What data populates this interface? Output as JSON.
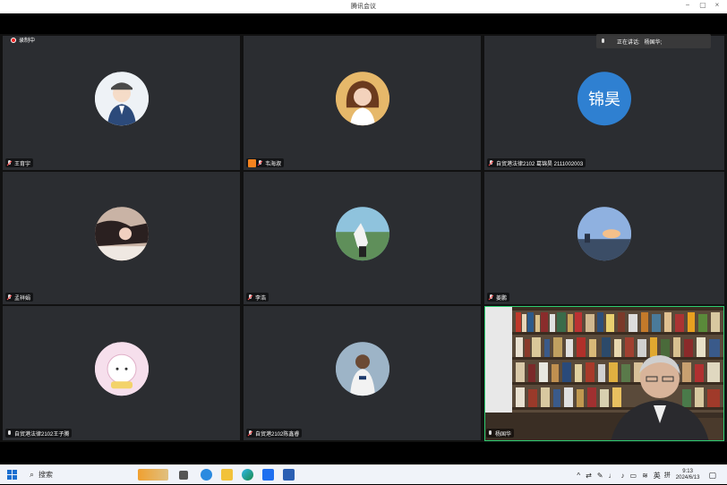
{
  "window": {
    "title": "腾讯会议",
    "controls": [
      "−",
      "▢",
      "×"
    ]
  },
  "recording": {
    "label": "录制中"
  },
  "speaking": {
    "label": "正在讲话:",
    "name": "杨国华;"
  },
  "participants": [
    {
      "name": "王育宇",
      "muted": true,
      "host": false,
      "avatar": "police-cartoon",
      "color": "#e8eef5"
    },
    {
      "name": "韦海淑",
      "muted": true,
      "host": true,
      "avatar": "woman-photo",
      "color": "#d9a35a"
    },
    {
      "name": "自贸港法律2102 葛锦昊 2111002003",
      "muted": true,
      "host": false,
      "avatar": "text",
      "avatar_text": "锦昊",
      "color": "#2f80d1"
    },
    {
      "name": "孟祥娟",
      "muted": true,
      "host": false,
      "avatar": "photo",
      "color": "#b99a8a"
    },
    {
      "name": "李浩",
      "muted": true,
      "host": false,
      "avatar": "landscape-photo",
      "color": "#6a9fb5"
    },
    {
      "name": "姜鹏",
      "muted": true,
      "host": false,
      "avatar": "sky-photo",
      "color": "#8aa8d8"
    },
    {
      "name": "自贸港法律2102王子腾",
      "muted": false,
      "host": false,
      "avatar": "cartoon-sheep",
      "color": "#f3d6e6"
    },
    {
      "name": "自贸港2102陈鑫睿",
      "muted": true,
      "host": false,
      "avatar": "sports-photo",
      "color": "#8fa9c0"
    },
    {
      "name": "杨国华",
      "muted": false,
      "host": false,
      "avatar": "video",
      "color": "#6b5b48"
    }
  ],
  "taskbar": {
    "search_label": "搜索",
    "ime": "英",
    "ime2": "拼",
    "time": "9:13",
    "date": "2024/6/13"
  }
}
